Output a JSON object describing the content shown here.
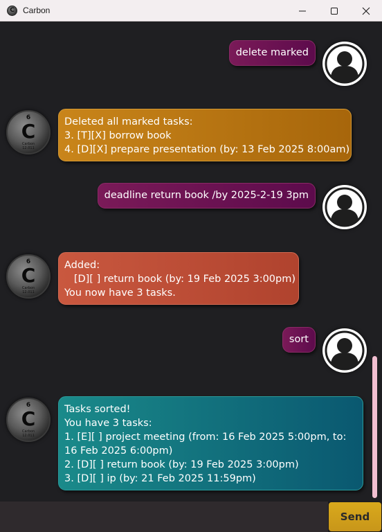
{
  "window": {
    "title": "Carbon",
    "icons": [
      "carbon-element-icon",
      "minimize-icon",
      "maximize-icon",
      "close-icon"
    ]
  },
  "avatar": {
    "element_number": "6",
    "element_symbol": "C",
    "element_caption": "Carbon\n12.011"
  },
  "messages": [
    {
      "sender": "user",
      "text": "delete marked"
    },
    {
      "sender": "bot",
      "text": "Deleted all marked tasks:\n3. [T][X] borrow book\n4. [D][X] prepare presentation (by: 13 Feb 2025 8:00am)"
    },
    {
      "sender": "user",
      "text": "deadline return book /by 2025-2-19 3pm"
    },
    {
      "sender": "bot",
      "text": "Added:\n   [D][ ] return book (by: 19 Feb 2025 3:00pm)\nYou now have 3 tasks."
    },
    {
      "sender": "user",
      "text": "sort"
    },
    {
      "sender": "bot",
      "text": "Tasks sorted!\nYou have 3 tasks:\n1. [E][ ] project meeting (from: 16 Feb 2025 5:00pm, to:\n16 Feb 2025 6:00pm)\n2. [D][ ] return book (by: 19 Feb 2025 3:00pm)\n3. [D][ ] ip (by: 21 Feb 2025 11:59pm)"
    }
  ],
  "input": {
    "value": "",
    "placeholder": ""
  },
  "send_button": {
    "label": "Send"
  },
  "colors": {
    "user_bubble": "#6b1252",
    "bot_bubble_1": "#b8771a",
    "bot_bubble_2": "#c04f38",
    "bot_bubble_3": "#127575",
    "send_button": "#d4a41c",
    "scrollbar": "#f2bfd1",
    "background": "#1f1f22"
  }
}
